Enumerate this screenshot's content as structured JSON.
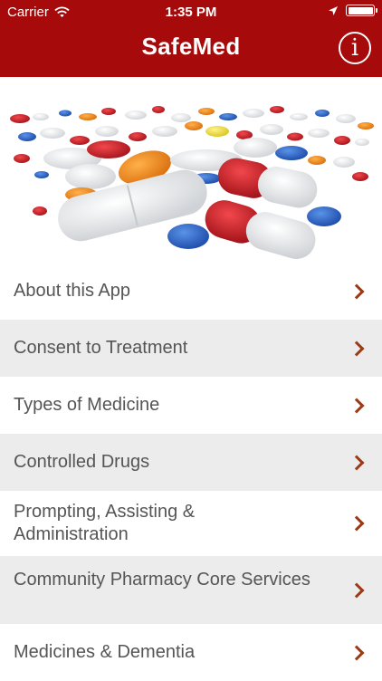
{
  "status_bar": {
    "carrier": "Carrier",
    "time": "1:35 PM"
  },
  "header": {
    "title": "SafeMed",
    "info_glyph": "i"
  },
  "colors": {
    "brand": "#a60a0a",
    "chevron": "#9c3a16",
    "row_alt": "#ececec",
    "text": "#555555"
  },
  "menu": {
    "items": [
      {
        "label": "About this App"
      },
      {
        "label": "Consent to Treatment"
      },
      {
        "label": "Types of Medicine"
      },
      {
        "label": "Controlled Drugs"
      },
      {
        "label": "Prompting, Assisting & Administration"
      },
      {
        "label": "Community Pharmacy Core Services"
      },
      {
        "label": "Medicines & Dementia"
      }
    ]
  }
}
